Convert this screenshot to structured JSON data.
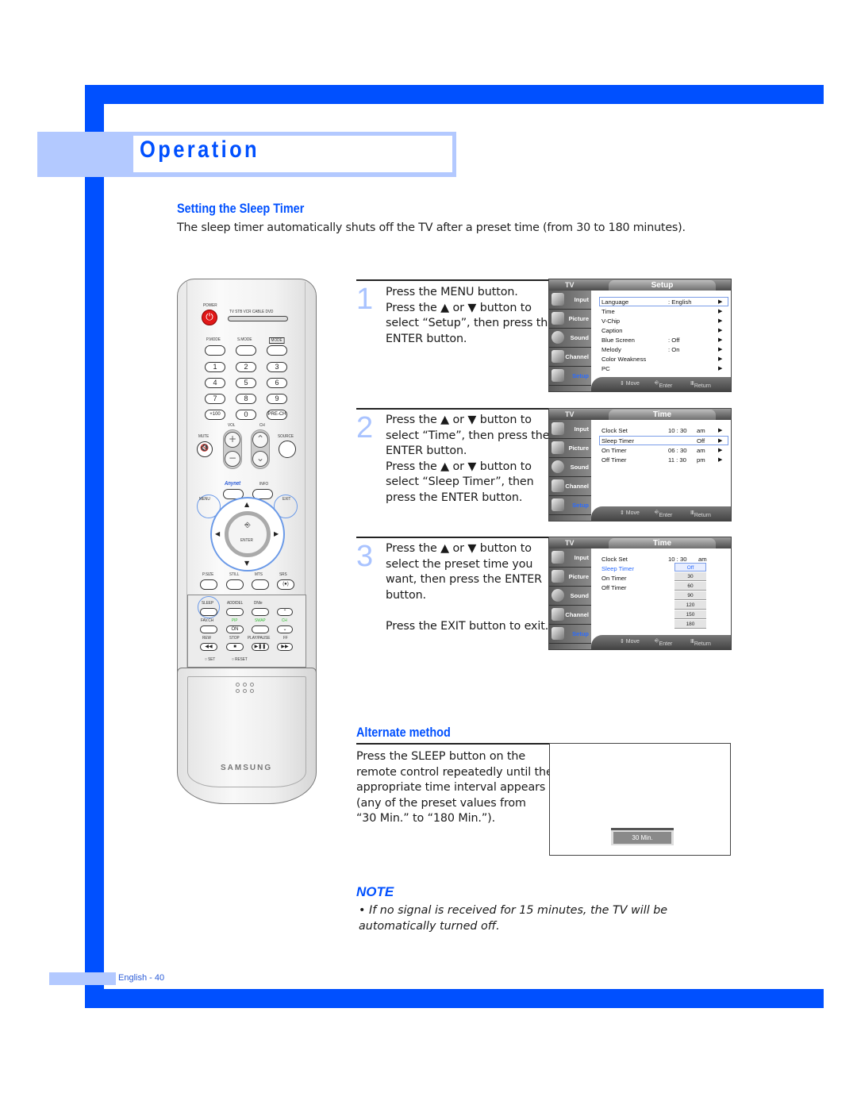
{
  "page": {
    "section": "Operation",
    "title": "Setting the Sleep Timer",
    "intro": "The sleep timer automatically shuts off the TV after a preset time (from 30 to 180 minutes).",
    "footer": "English - 40",
    "accent_color": "#0050ff",
    "light_accent_color": "#b3c9ff"
  },
  "remote": {
    "power_label": "POWER",
    "source_modes": "TV  STB  VCR  CABLE  DVD",
    "mode_labels": [
      "P.MODE",
      "S.MODE",
      "MODE"
    ],
    "number_keys": [
      "1",
      "2",
      "3",
      "4",
      "5",
      "6",
      "7",
      "8",
      "9",
      "+100",
      "0",
      "PRE-CH"
    ],
    "vol_label": "VOL",
    "ch_label": "CH",
    "mute_label": "MUTE",
    "source_label": "SOURCE",
    "anynet_label": "Anynet",
    "info_label": "INFO",
    "menu_label": "MENU",
    "exit_label": "EXIT",
    "enter_label": "ENTER",
    "row_labels": [
      "P.SIZE",
      "STILL",
      "MTS",
      "SRS"
    ],
    "panel_row1": [
      "SLEEP",
      "ADD/DEL",
      "DNIe"
    ],
    "panel_row2": [
      "FAV.CH",
      "PIP",
      "SWAP",
      "CH"
    ],
    "pip_on": "ON",
    "panel_row3": [
      "REW",
      "STOP",
      "PLAY/PAUSE",
      "FF"
    ],
    "set_label": "SET",
    "reset_label": "RESET",
    "brand": "SAMSUNG"
  },
  "steps": [
    {
      "number": "1",
      "text": "Press the MENU button.\nPress the ▲ or ▼ button to\nselect “Setup”, then press the\nENTER button."
    },
    {
      "number": "2",
      "text": "Press the ▲ or ▼ button to\nselect “Time”, then press the\nENTER button.\nPress the ▲ or ▼ button to\nselect “Sleep Timer”, then\npress the ENTER button."
    },
    {
      "number": "3",
      "text": "Press the ▲ or ▼ button to\nselect the preset time you\nwant, then press the ENTER\nbutton.\n\nPress the EXIT button to exit."
    }
  ],
  "osd_common": {
    "tv_label": "TV",
    "sidebar": [
      "Input",
      "Picture",
      "Sound",
      "Channel",
      "Setup"
    ],
    "active_sidebar": "Setup",
    "footer_move": "⇕ Move",
    "footer_enter": "Enter",
    "footer_return": "Return"
  },
  "osd_setup": {
    "title": "Setup",
    "rows": [
      {
        "label": "Language",
        "value": ": English"
      },
      {
        "label": "Time",
        "value": ""
      },
      {
        "label": "V-Chip",
        "value": ""
      },
      {
        "label": "Caption",
        "value": ""
      },
      {
        "label": "Blue Screen",
        "value": ": Off"
      },
      {
        "label": "Melody",
        "value": ": On"
      },
      {
        "label": "Color Weakness",
        "value": ""
      },
      {
        "label": "PC",
        "value": ""
      }
    ],
    "selected": "Language"
  },
  "osd_time": {
    "title": "Time",
    "rows": [
      {
        "label": "Clock Set",
        "value": "10 : 30",
        "ampm": "am"
      },
      {
        "label": "Sleep Timer",
        "value": "Off",
        "ampm": ""
      },
      {
        "label": "On Timer",
        "value": "06 : 30",
        "ampm": "am"
      },
      {
        "label": "Off Timer",
        "value": "11 : 30",
        "ampm": "pm"
      }
    ],
    "selected": "Sleep Timer"
  },
  "osd_sleep": {
    "title": "Time",
    "clock_label": "Clock Set",
    "clock_value": "10 : 30",
    "clock_ampm": "am",
    "rows": [
      "Sleep Timer",
      "On Timer",
      "Off Timer"
    ],
    "options": [
      "Off",
      "30",
      "60",
      "90",
      "120",
      "150",
      "180"
    ],
    "selected_option": "Off"
  },
  "alternate": {
    "title": "Alternate method",
    "text": "Press the SLEEP button on the\nremote control repeatedly until the\nappropriate time interval appears\n(any of the preset values from\n“30 Min.” to “180 Min.”).",
    "osd_value": "30 Min."
  },
  "note": {
    "title": "NOTE",
    "text": "•  If no signal is received for 15 minutes, the TV will be\n    automatically turned off."
  }
}
